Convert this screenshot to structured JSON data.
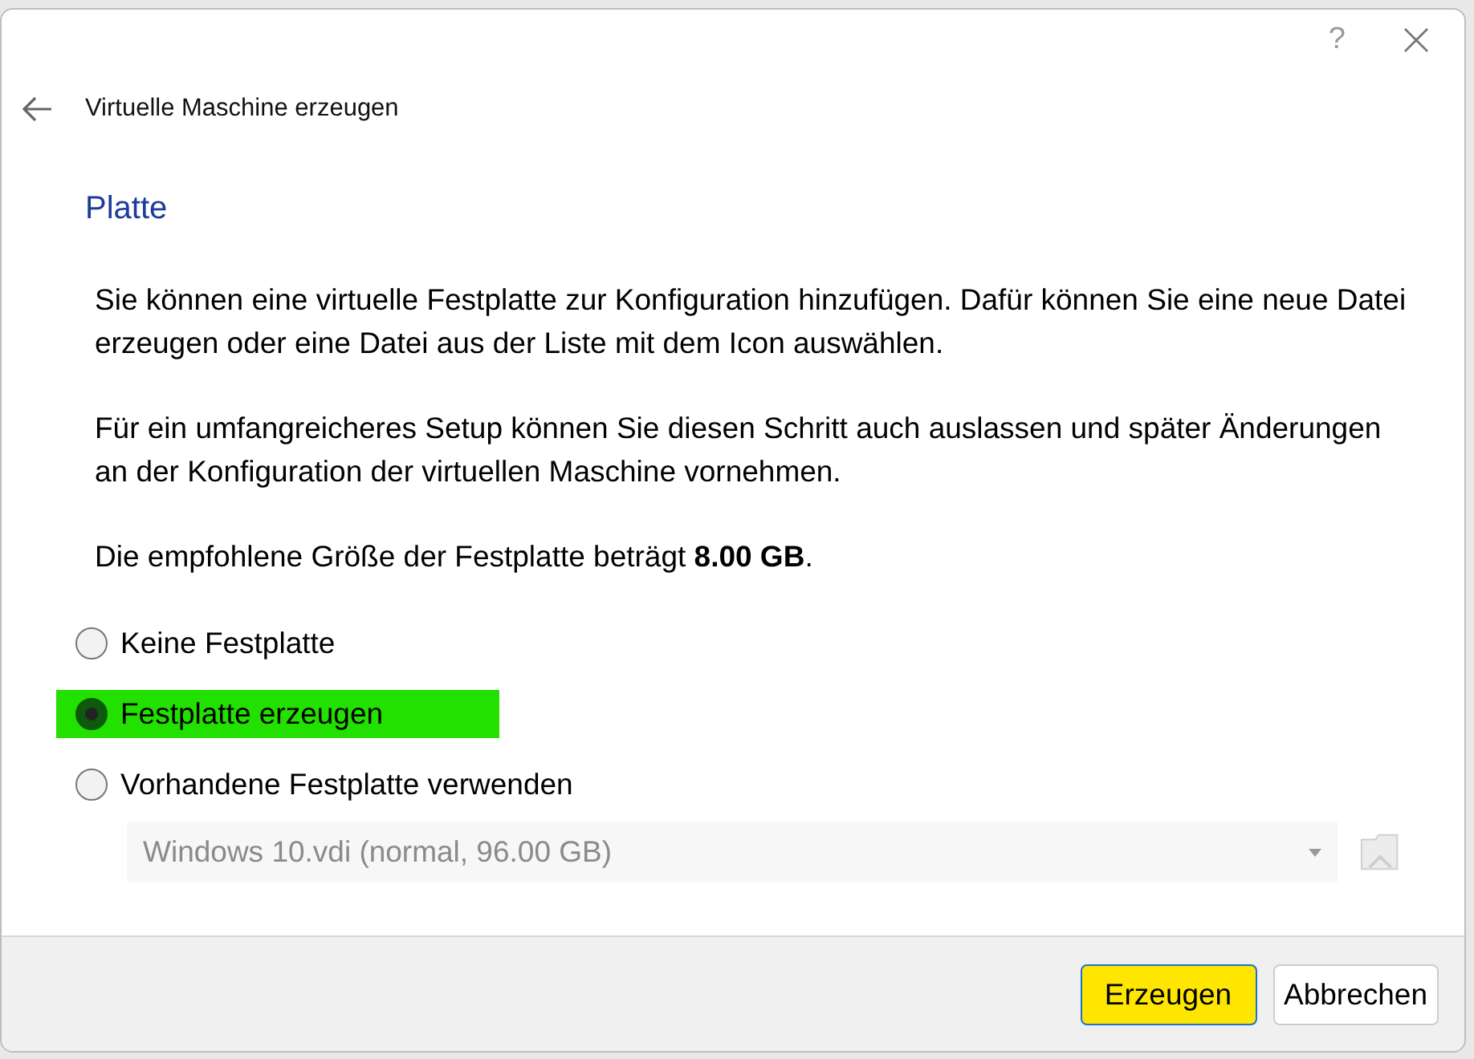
{
  "window": {
    "help": "?"
  },
  "header": {
    "title": "Virtuelle Maschine erzeugen"
  },
  "section_title": "Platte",
  "paragraphs": [
    "Sie können eine virtuelle Festplatte zur Konfiguration hinzufügen. Dafür können Sie eine neue Datei erzeugen oder eine Datei aus der Liste mit dem Icon auswählen.",
    "Für ein umfangreicheres Setup können Sie diesen Schritt auch auslassen und später Änderungen an der Konfiguration der virtuellen Maschine vornehmen.",
    "Die empfohlene Größe der Festplatte beträgt **8.00 GB**."
  ],
  "options": [
    {
      "label": "Keine Festplatte",
      "selected": false,
      "highlighted": false
    },
    {
      "label": "Festplatte erzeugen",
      "selected": true,
      "highlighted": true
    },
    {
      "label": "Vorhandene Festplatte verwenden",
      "selected": false,
      "highlighted": false
    }
  ],
  "disk_select": {
    "value": "Windows 10.vdi (normal, 96.00 GB)",
    "disabled": true
  },
  "buttons": [
    {
      "label": "Erzeugen",
      "highlighted": true
    },
    {
      "label": "Abbrechen",
      "highlighted": false
    }
  ]
}
